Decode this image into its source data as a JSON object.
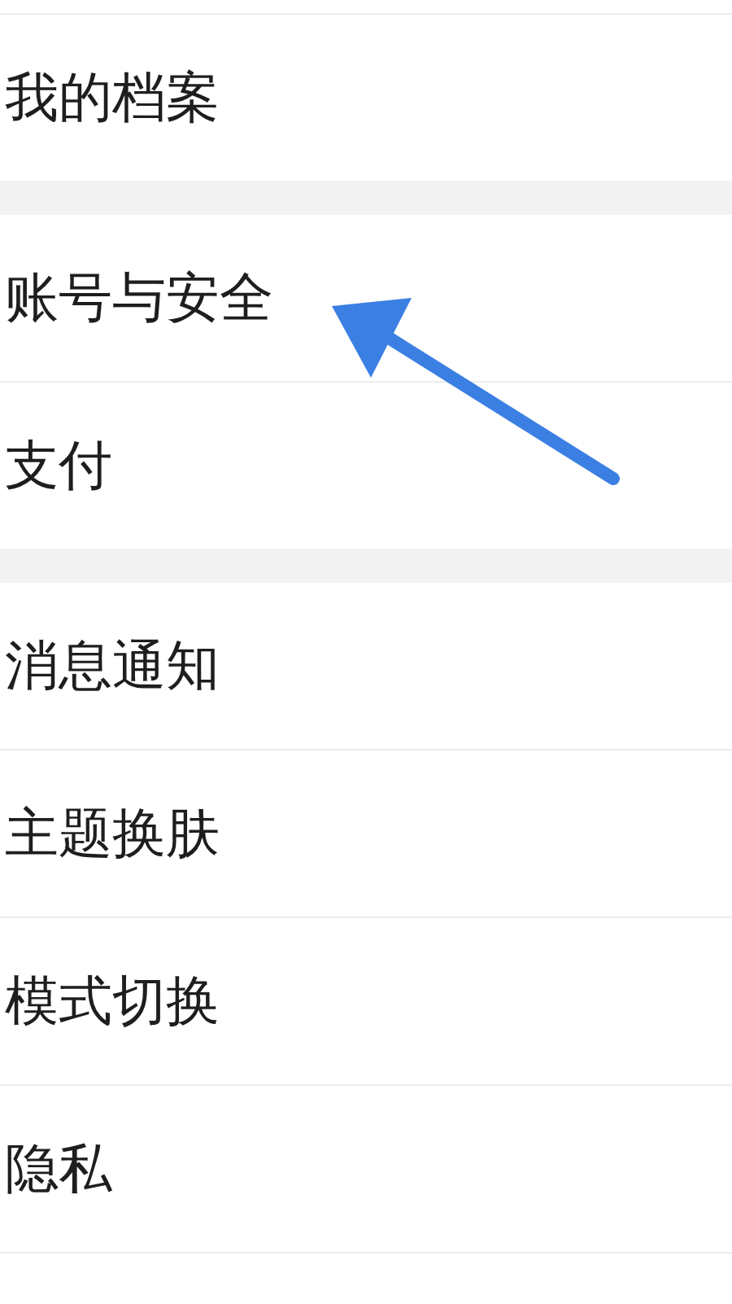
{
  "sections": [
    {
      "items": [
        {
          "label": "我的档案"
        }
      ]
    },
    {
      "items": [
        {
          "label": "账号与安全"
        },
        {
          "label": "支付"
        }
      ]
    },
    {
      "items": [
        {
          "label": "消息通知"
        },
        {
          "label": "主题换肤"
        },
        {
          "label": "模式切换"
        },
        {
          "label": "隐私"
        }
      ]
    }
  ]
}
